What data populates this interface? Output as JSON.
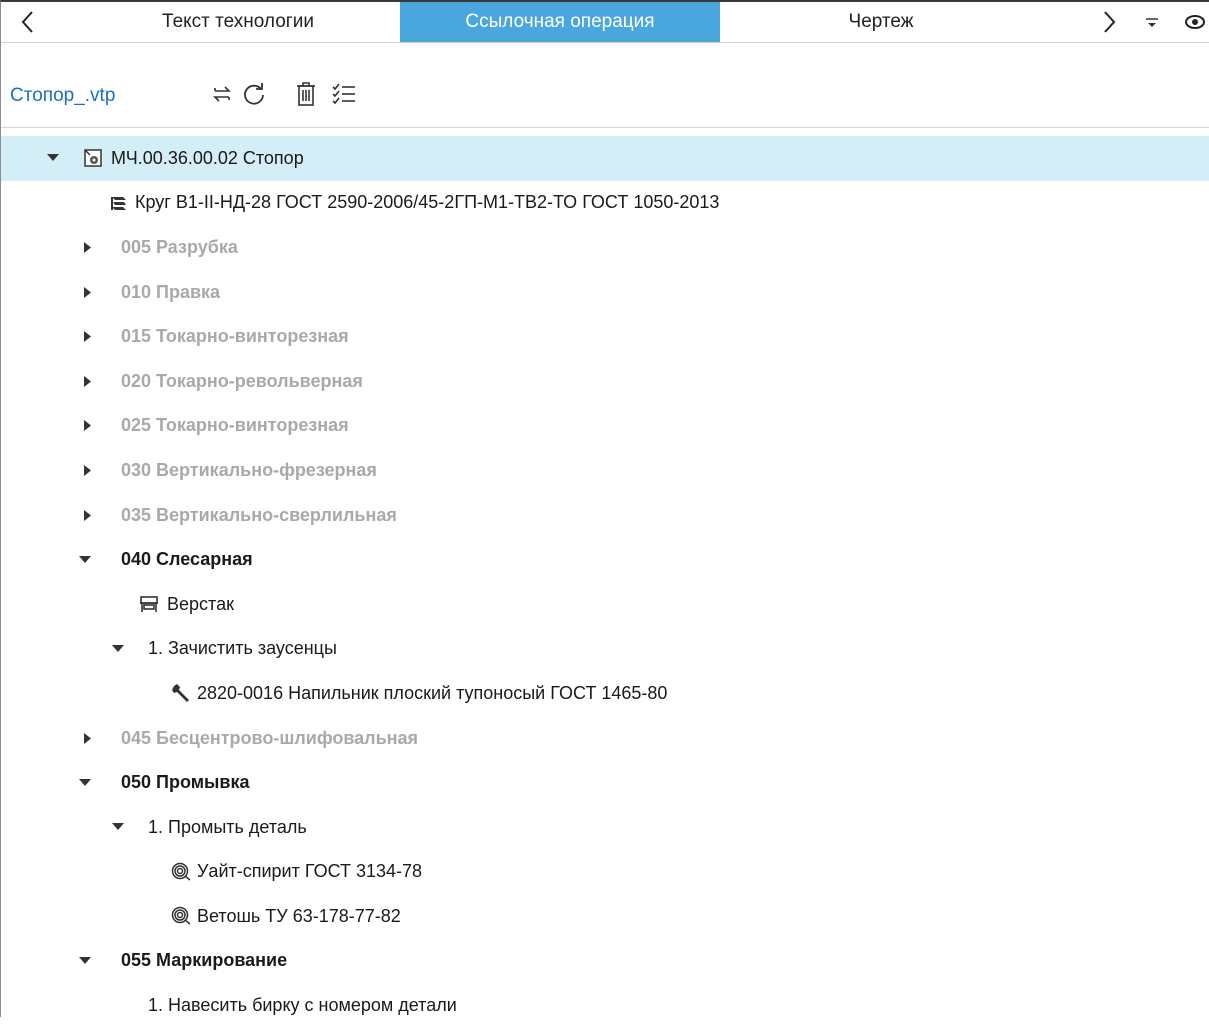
{
  "tabs": {
    "prev_icon": "chevron-left-icon",
    "items": [
      {
        "label": "Текст технологии"
      },
      {
        "label": "Ссылочная операция"
      },
      {
        "label": "Чертеж"
      }
    ],
    "next_icon": "chevron-right-icon",
    "overflow_icon": "overflow-menu-icon",
    "view_icon": "eye-icon",
    "active_color": "#4aa7de"
  },
  "toolbar": {
    "file_name": "Стопор_.vtp",
    "icons": [
      "swap-icon",
      "refresh-icon",
      "delete-icon",
      "checklist-icon"
    ]
  },
  "tree": {
    "selected_color": "#d3eef7",
    "root": {
      "label": "МЧ.00.36.00.02 Стопор",
      "icon": "part-icon"
    },
    "material": {
      "label": "Круг В1-II-НД-28 ГОСТ 2590-2006/45-2ГП-М1-ТВ2-ТО ГОСТ 1050-2013",
      "icon": "material-icon"
    },
    "ops_collapsed": [
      "005 Разрубка",
      "010 Правка",
      "015 Токарно-винторезная",
      "020 Токарно-револьверная",
      "025 Токарно-винторезная",
      "030 Вертикально-фрезерная",
      "035 Вертикально-сверлильная"
    ],
    "op040": {
      "label": "040 Слесарная",
      "equipment": "Верстак",
      "step": "1. Зачистить заусенцы",
      "tool": "2820-0016 Напильник плоский тупоносый ГОСТ 1465-80"
    },
    "op045": "045 Бесцентрово-шлифовальная",
    "op050": {
      "label": "050 Промывка",
      "step": "1. Промыть деталь",
      "aux1": "Уайт-спирит ГОСТ 3134-78",
      "aux2": "Ветошь ТУ 63-178-77-82"
    },
    "op055": {
      "label": "055 Маркирование",
      "step": "1. Навесить бирку с номером детали"
    }
  }
}
